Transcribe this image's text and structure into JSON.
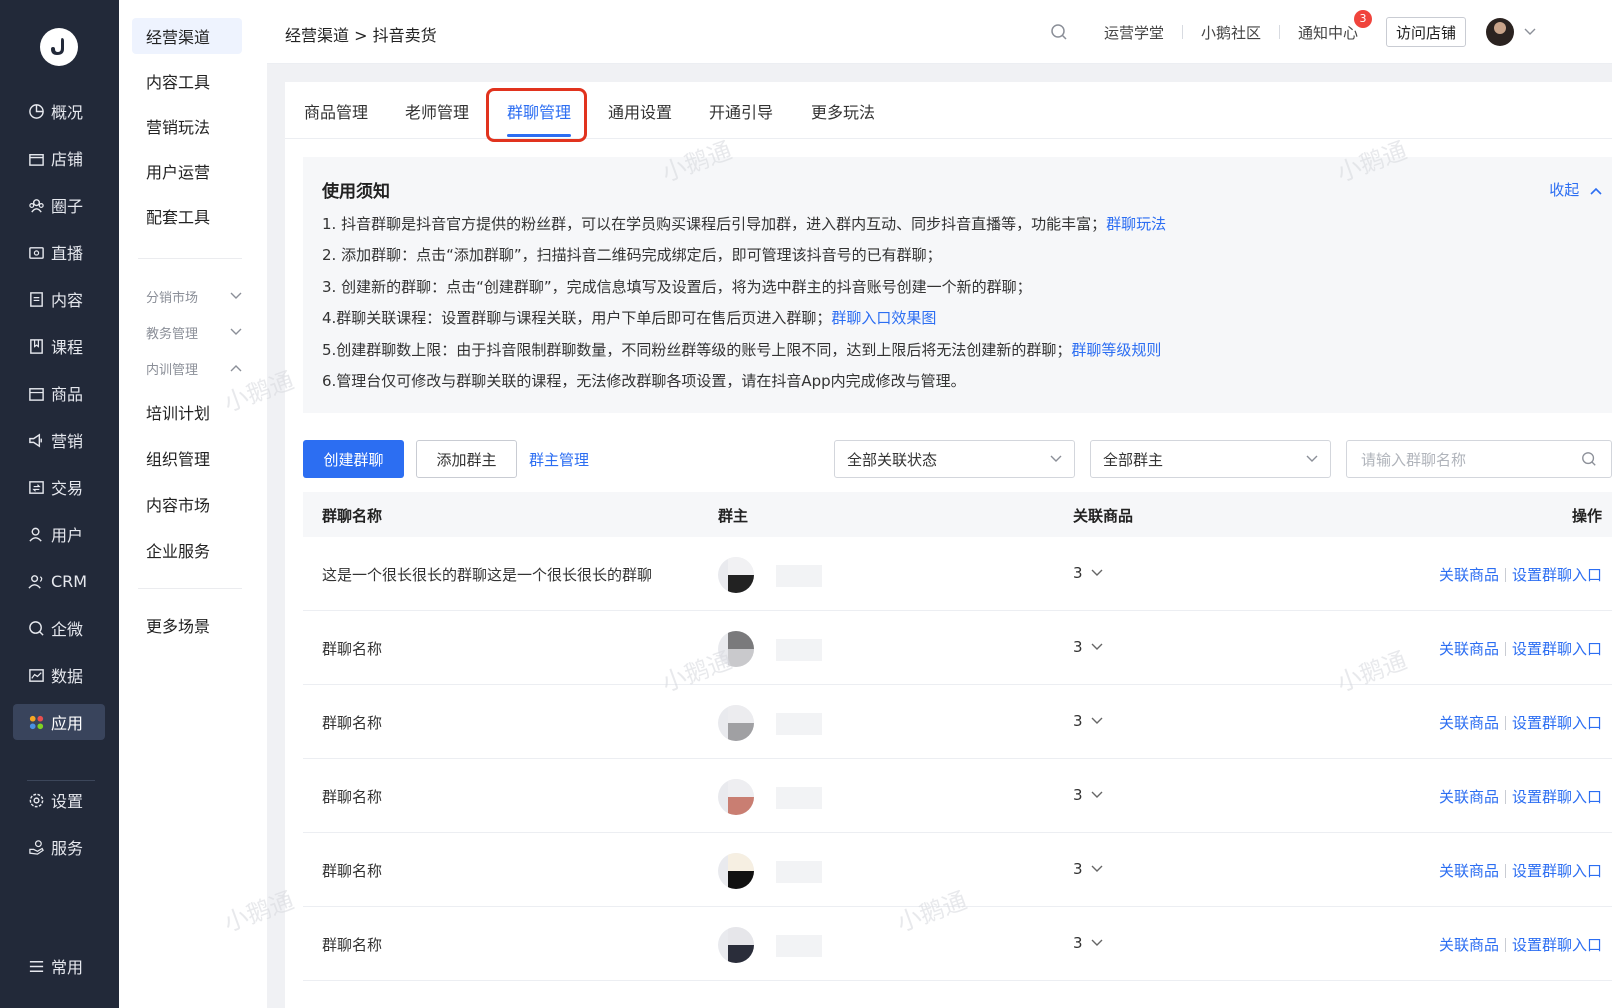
{
  "nav": {
    "items": [
      {
        "label": "概况",
        "icon": "overview-icon"
      },
      {
        "label": "店铺",
        "icon": "store-icon"
      },
      {
        "label": "圈子",
        "icon": "circle-icon"
      },
      {
        "label": "直播",
        "icon": "live-icon"
      },
      {
        "label": "内容",
        "icon": "content-icon"
      },
      {
        "label": "课程",
        "icon": "course-icon"
      },
      {
        "label": "商品",
        "icon": "goods-icon"
      },
      {
        "label": "营销",
        "icon": "marketing-icon"
      },
      {
        "label": "交易",
        "icon": "trade-icon"
      },
      {
        "label": "用户",
        "icon": "user-icon"
      },
      {
        "label": "CRM",
        "icon": "crm-icon"
      },
      {
        "label": "企微",
        "icon": "wecom-icon"
      },
      {
        "label": "数据",
        "icon": "data-icon"
      },
      {
        "label": "应用",
        "icon": "apps-icon"
      },
      {
        "label": "设置",
        "icon": "settings-icon"
      },
      {
        "label": "服务",
        "icon": "service-icon"
      },
      {
        "label": "常用",
        "icon": "frequent-icon"
      }
    ]
  },
  "sub": {
    "items": [
      "经营渠道",
      "内容工具",
      "营销玩法",
      "用户运营",
      "配套工具"
    ],
    "groups": [
      "分销市场",
      "教务管理",
      "内训管理"
    ],
    "training_items": [
      "培训计划",
      "组织管理",
      "内容市场",
      "企业服务"
    ],
    "more": "更多场景"
  },
  "header": {
    "breadcrumb": "经营渠道 > 抖音卖货",
    "links": [
      "运营学堂",
      "小鹅社区",
      "通知中心"
    ],
    "notice_count": "3",
    "visit_store": "访问店铺"
  },
  "tabs": [
    "商品管理",
    "老师管理",
    "群聊管理",
    "通用设置",
    "开通引导",
    "更多玩法"
  ],
  "notice": {
    "title": "使用须知",
    "collapse": "收起",
    "lines": [
      {
        "text": "1. 抖音群聊是抖音官方提供的粉丝群，可以在学员购买课程后引导加群，进入群内互动、同步抖音直播等，功能丰富；",
        "link": "群聊玩法"
      },
      {
        "text": "2. 添加群聊：点击“添加群聊”，扫描抖音二维码完成绑定后，即可管理该抖音号的已有群聊；",
        "link": ""
      },
      {
        "text": "3. 创建新的群聊：点击“创建群聊”，完成信息填写及设置后，将为选中群主的抖音账号创建一个新的群聊；",
        "link": ""
      },
      {
        "text": "4.群聊关联课程：设置群聊与课程关联，用户下单后即可在售后页进入群聊；",
        "link": "群聊入口效果图"
      },
      {
        "text": "5.创建群聊数上限：由于抖音限制群聊数量，不同粉丝群等级的账号上限不同，达到上限后将无法创建新的群聊；",
        "link": "群聊等级规则"
      },
      {
        "text": "6.管理台仅可修改与群聊关联的课程，无法修改群聊各项设置，请在抖音App内完成修改与管理。",
        "link": ""
      }
    ]
  },
  "toolbar": {
    "create": "创建群聊",
    "add_owner": "添加群主",
    "owner_manage": "群主管理",
    "status_select": "全部关联状态",
    "owner_select": "全部群主",
    "search_placeholder": "请输入群聊名称"
  },
  "table": {
    "headers": [
      "群聊名称",
      "群主",
      "关联商品",
      "操作"
    ],
    "rows": [
      {
        "name": "这是一个很长很长的群聊这是一个很长很长的群聊",
        "goods": "3"
      },
      {
        "name": "群聊名称",
        "goods": "3"
      },
      {
        "name": "群聊名称",
        "goods": "3"
      },
      {
        "name": "群聊名称",
        "goods": "3"
      },
      {
        "name": "群聊名称",
        "goods": "3"
      },
      {
        "name": "群聊名称",
        "goods": "3"
      }
    ],
    "op_link_goods": "关联商品",
    "op_set_entry": "设置群聊入口"
  },
  "watermark": "小鹅通",
  "colors": {
    "accent": "#2c6ef2",
    "nav_bg": "#222939",
    "highlight": "#e1331e"
  }
}
